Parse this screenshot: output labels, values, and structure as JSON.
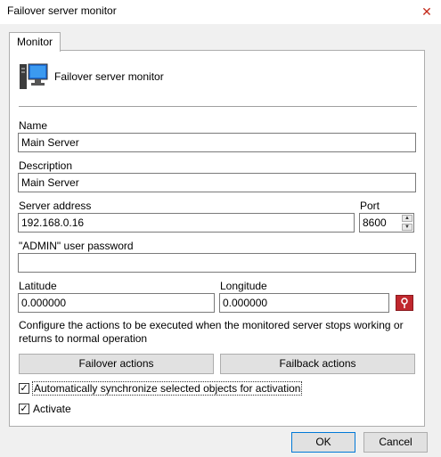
{
  "window": {
    "title": "Failover server monitor",
    "close_glyph": "✕"
  },
  "tabs": [
    {
      "label": "Monitor",
      "selected": true
    }
  ],
  "header": {
    "title": "Failover server monitor",
    "icon": "server-monitor-icon"
  },
  "fields": {
    "name": {
      "label": "Name",
      "value": "Main Server"
    },
    "description": {
      "label": "Description",
      "value": "Main Server"
    },
    "server_address": {
      "label": "Server address",
      "value": "192.168.0.16"
    },
    "port": {
      "label": "Port",
      "value": "8600"
    },
    "admin_password": {
      "label": "\"ADMIN\" user password",
      "value": ""
    },
    "latitude": {
      "label": "Latitude",
      "value": "0.000000"
    },
    "longitude": {
      "label": "Longitude",
      "value": "0.000000"
    }
  },
  "description_text": "Configure the actions to be executed when the monitored server stops working or returns to normal operation",
  "buttons": {
    "failover": "Failover actions",
    "failback": "Failback actions",
    "ok": "OK",
    "cancel": "Cancel"
  },
  "checkboxes": {
    "auto_sync": {
      "label": "Automatically synchronize selected objects for activation",
      "checked": true
    },
    "activate": {
      "label": "Activate",
      "checked": true
    }
  },
  "colors": {
    "map_button": "#c0272d",
    "accent": "#0078d7"
  }
}
